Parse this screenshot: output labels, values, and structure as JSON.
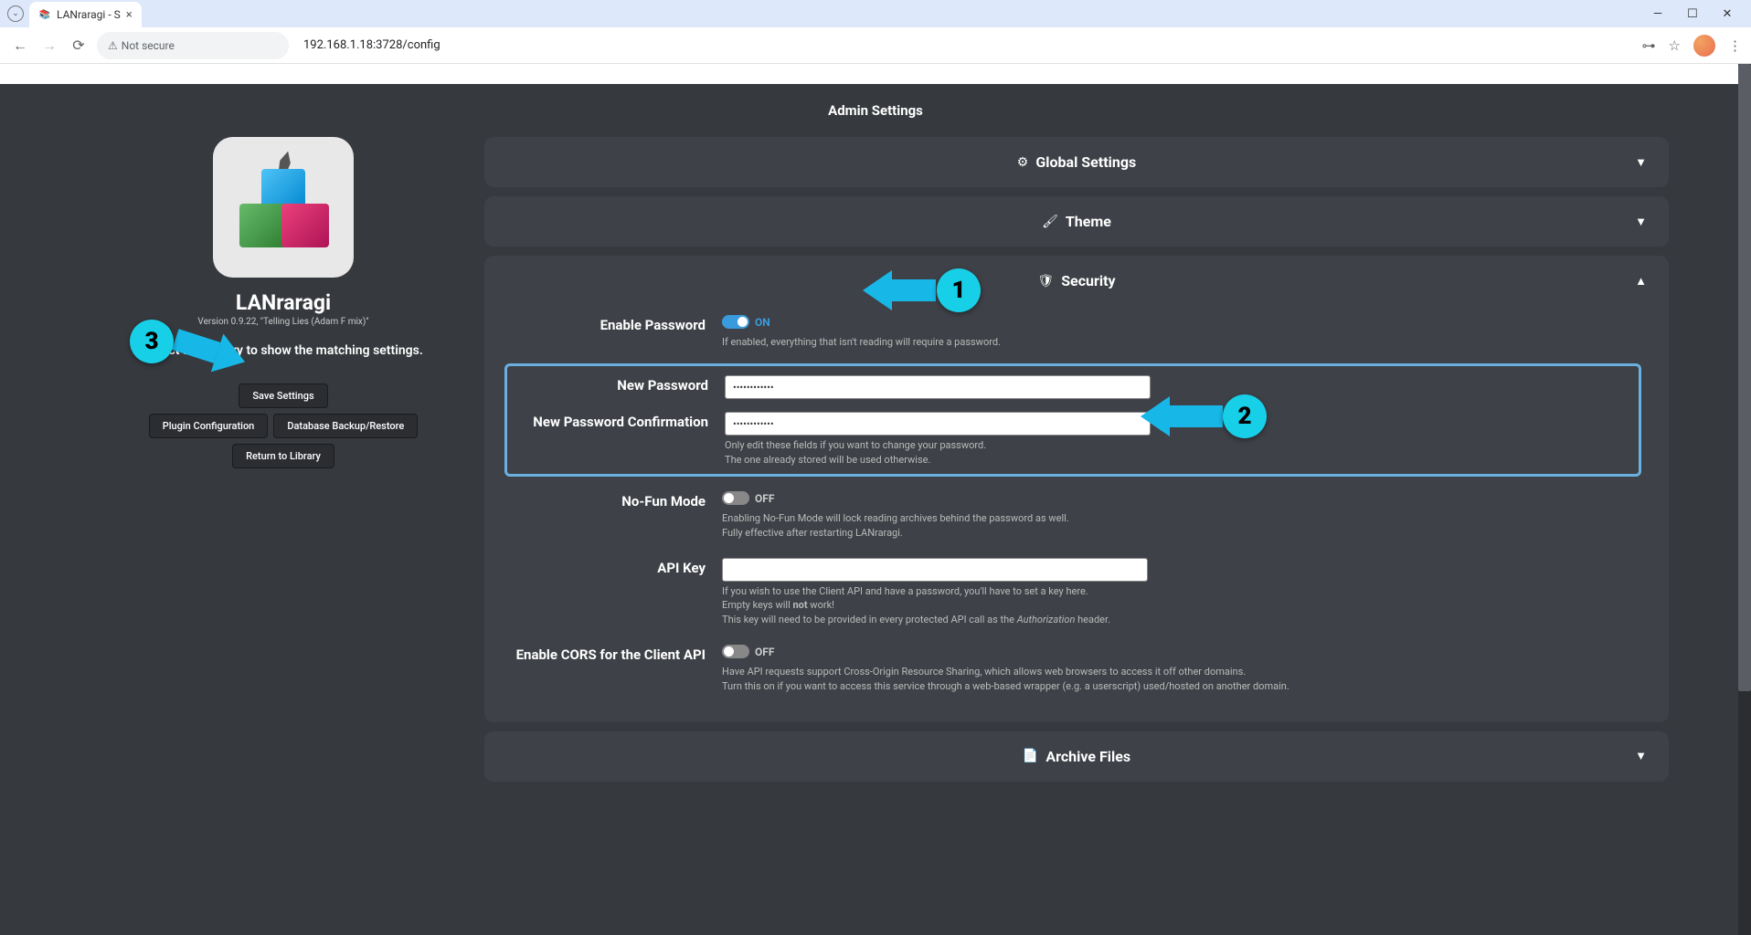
{
  "browser": {
    "tab_title": "LANraragi - S",
    "not_secure_label": "Not secure",
    "url": "192.168.1.18:3728/config"
  },
  "header": {
    "title": "Admin Settings"
  },
  "sidebar": {
    "app_name": "LANraragi",
    "version": "Version 0.9.22, \"Telling Lies (Adam F mix)\"",
    "hint": "Select a category to show the matching settings.",
    "buttons": {
      "save": "Save Settings",
      "plugin": "Plugin Configuration",
      "backup": "Database Backup/Restore",
      "return": "Return to Library"
    }
  },
  "accordions": {
    "global": "Global Settings",
    "theme": "Theme",
    "security": "Security",
    "archive": "Archive Files"
  },
  "security": {
    "enable_password": {
      "label": "Enable Password",
      "state": "ON",
      "desc": "If enabled, everything that isn't reading will require a password."
    },
    "new_password": {
      "label": "New Password",
      "value": "••••••••••••"
    },
    "new_password_confirm": {
      "label": "New Password Confirmation",
      "value": "••••••••••••",
      "desc1": "Only edit these fields if you want to change your password.",
      "desc2": "The one already stored will be used otherwise."
    },
    "nofun": {
      "label": "No-Fun Mode",
      "state": "OFF",
      "desc1": "Enabling No-Fun Mode will lock reading archives behind the password as well.",
      "desc2": "Fully effective after restarting LANraragi."
    },
    "api_key": {
      "label": "API Key",
      "value": "",
      "desc1": "If you wish to use the Client API and have a password, you'll have to set a key here.",
      "desc2a": "Empty keys will ",
      "desc2b": "not",
      "desc2c": " work!",
      "desc3a": "This key will need to be provided in every protected API call as the ",
      "desc3b": "Authorization",
      "desc3c": " header."
    },
    "cors": {
      "label": "Enable CORS for the Client API",
      "state": "OFF",
      "desc1": "Have API requests support Cross-Origin Resource Sharing, which allows web browsers to access it off other domains.",
      "desc2": "Turn this on if you want to access this service through a web-based wrapper (e.g. a userscript) used/hosted on another domain."
    }
  },
  "annotations": {
    "one": "1",
    "two": "2",
    "three": "3"
  }
}
